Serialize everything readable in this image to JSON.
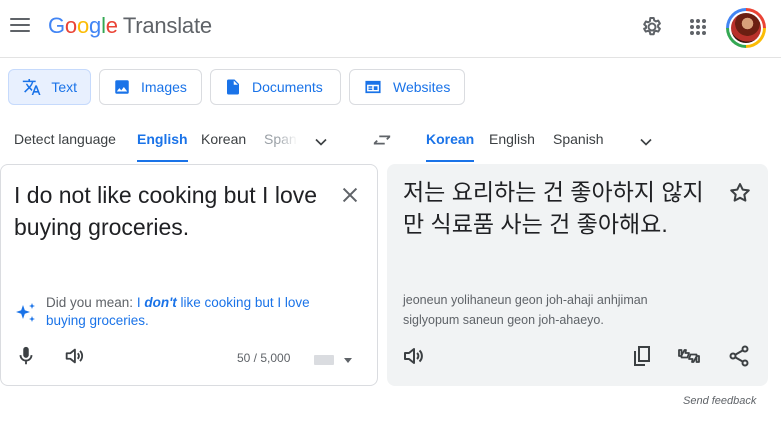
{
  "header": {
    "logo_letters": [
      "G",
      "o",
      "o",
      "g",
      "l",
      "e"
    ],
    "product": "Translate",
    "icons": {
      "menu": "menu-icon",
      "settings": "gear-icon",
      "apps": "apps-grid-icon",
      "account": "avatar"
    }
  },
  "modes": [
    {
      "label": "Text",
      "icon": "translate-icon",
      "active": true
    },
    {
      "label": "Images",
      "icon": "image-icon",
      "active": false
    },
    {
      "label": "Documents",
      "icon": "document-icon",
      "active": false
    },
    {
      "label": "Websites",
      "icon": "website-icon",
      "active": false
    }
  ],
  "source_langs": {
    "detect": "Detect language",
    "tabs": [
      "English",
      "Korean",
      "Span"
    ],
    "active": "English"
  },
  "target_langs": {
    "tabs": [
      "Korean",
      "English",
      "Spanish"
    ],
    "active": "Korean"
  },
  "source": {
    "text": "I do not like cooking but I love buying groceries.",
    "did_you_mean_label": "Did you mean:",
    "suggestion_pre": "I ",
    "suggestion_em": "don't",
    "suggestion_post": " like cooking but I love buying groceries.",
    "char_count": "50 / 5,000"
  },
  "target": {
    "text": "저는 요리하는 건 좋아하지 않지만 식료품 사는 건 좋아해요.",
    "romanization": "jeoneun yolihaneun geon joh-ahaji anhjiman siglyopum saneun geon joh-ahaeyo."
  },
  "footer": {
    "feedback": "Send feedback"
  },
  "colors": {
    "accent": "#1a73e8",
    "panel_bg": "#f1f3f4",
    "active_mode_bg": "#e8f0fe"
  }
}
